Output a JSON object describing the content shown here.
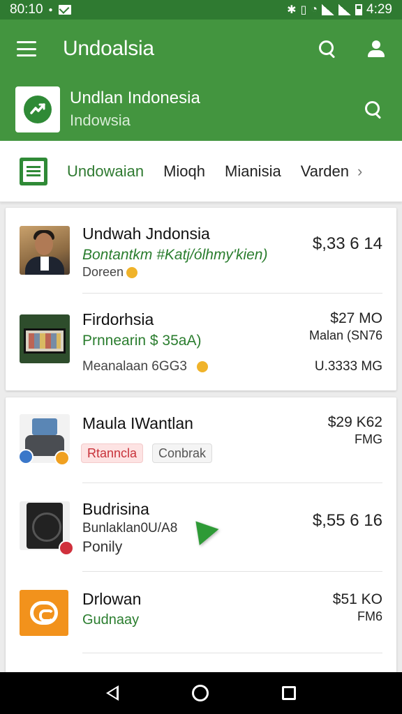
{
  "status_bar": {
    "time_left": "80:10",
    "time_right": "4:29"
  },
  "app_bar": {
    "title": "Undoalsia"
  },
  "sub_header": {
    "title": "Undlan Indonesia",
    "subtitle": "Indowsia"
  },
  "tabs": [
    {
      "label": "Undowaian",
      "active": true
    },
    {
      "label": "Mioqh",
      "active": false
    },
    {
      "label": "Mianisia",
      "active": false
    },
    {
      "label": "Varden",
      "active": false
    }
  ],
  "items": [
    {
      "title": "Undwah Jndonsia",
      "subtitle": "Bontantkm #Katj/ólhmy'kien)",
      "meta": "Doreen",
      "price": "$,33 6 14"
    },
    {
      "title": "Firdorhsia",
      "subtitle": "Prnnearin $ 35aA)",
      "meta": "Meanalaan 6GG3",
      "price": "$27 MO",
      "price_sub": "Malan (SN76",
      "price_sub2": "U.3333 MG"
    },
    {
      "title": "Maula IWantlan",
      "chip_red": "Rtanncla",
      "chip_gray": "Conbrak",
      "price": "$29 K62",
      "price_sub": "FMG"
    },
    {
      "title": "Budrisina",
      "subtitle": "Bunlaklan0U/A8",
      "meta": "Ponily",
      "price": "$,55 6 16"
    },
    {
      "title": "Drlowan",
      "subtitle": "Gudnaay",
      "price": "$51 KO",
      "price_sub": "FM6"
    }
  ],
  "colors": {
    "primary": "#43953f",
    "status": "#2f7a31",
    "accent": "#2a7d2e"
  }
}
